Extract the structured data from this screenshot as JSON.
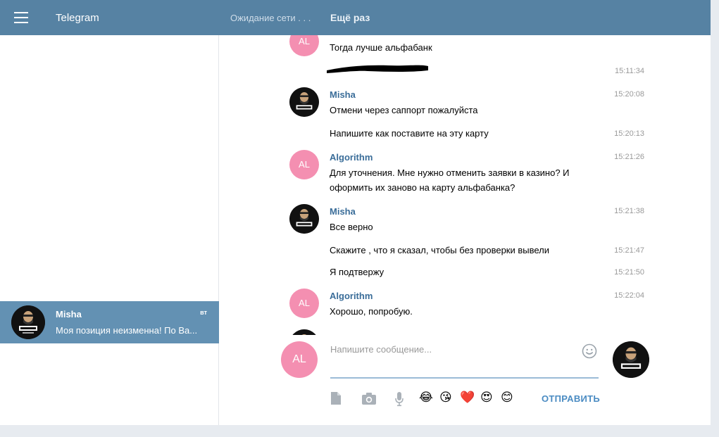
{
  "header": {
    "app_title": "Telegram",
    "network_status": "Ожидание сети . . .",
    "retry_label": "Ещё раз",
    "bar_color": "#5682a3"
  },
  "sidebar": {
    "dialogs": [
      {
        "name": "Misha",
        "date": "вт",
        "preview": "Моя позиция неизменна! По Ва...",
        "selected": true
      }
    ]
  },
  "chat": {
    "avatar_initials": "AL",
    "messages": [
      {
        "author": "",
        "avatar": "AL",
        "text": "Тогда лучше альфабанк",
        "time": ""
      },
      {
        "author": "",
        "avatar": "",
        "text": "",
        "time": "15:11:34",
        "redacted": true
      },
      {
        "author": "Misha",
        "avatar": "misha",
        "text": "Отмени через саппорт пожалуйста",
        "time": "15:20:08"
      },
      {
        "author": "",
        "avatar": "",
        "text": "Напишите как поставите на эту карту",
        "time": "15:20:13"
      },
      {
        "author": "Algorithm",
        "avatar": "AL",
        "text": "Для уточнения. Мне нужно отменить заявки в казино? И оформить их заново на карту альфабанка?",
        "time": "15:21:26"
      },
      {
        "author": "Misha",
        "avatar": "misha",
        "text": "Все верно",
        "time": "15:21:38"
      },
      {
        "author": "",
        "avatar": "",
        "text": "Скажите , что я сказал, чтобы без проверки вывели",
        "time": "15:21:47"
      },
      {
        "author": "",
        "avatar": "",
        "text": "Я подтвержу",
        "time": "15:21:50"
      },
      {
        "author": "Algorithm",
        "avatar": "AL",
        "text": "Хорошо, попробую.",
        "time": "15:22:04"
      }
    ]
  },
  "composer": {
    "placeholder": "Напишите сообщение...",
    "send_label": "ОТПРАВИТЬ",
    "emojis": [
      "😂",
      "😘",
      "❤️",
      "😍",
      "😊"
    ]
  },
  "icons": {
    "menu": "hamburger-icon",
    "file": "file-icon",
    "camera": "camera-icon",
    "mic": "microphone-icon",
    "emoji": "smiley-icon"
  }
}
